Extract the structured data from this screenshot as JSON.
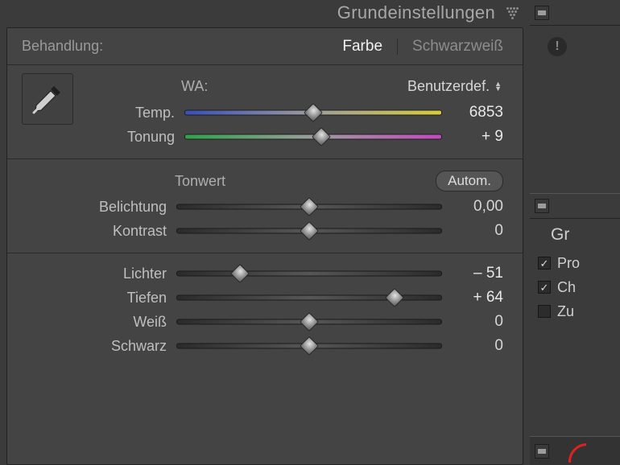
{
  "panel": {
    "title": "Grundeinstellungen",
    "treatment_label": "Behandlung:",
    "tabs": {
      "color": "Farbe",
      "bw": "Schwarzweiß"
    },
    "wa": {
      "label": "WA:",
      "dropdown": "Benutzerdef."
    },
    "sliders": {
      "temp": {
        "label": "Temp.",
        "value": "6853",
        "pos": 50
      },
      "tint": {
        "label": "Tonung",
        "value": "+ 9",
        "pos": 53
      },
      "exposure": {
        "label": "Belichtung",
        "value": "0,00",
        "pos": 50
      },
      "contrast": {
        "label": "Kontrast",
        "value": "0",
        "pos": 50
      },
      "highlights": {
        "label": "Lichter",
        "value": "– 51",
        "pos": 24
      },
      "shadows": {
        "label": "Tiefen",
        "value": "+ 64",
        "pos": 82
      },
      "whites": {
        "label": "Weiß",
        "value": "0",
        "pos": 50
      },
      "blacks": {
        "label": "Schwarz",
        "value": "0",
        "pos": 50
      }
    },
    "tone_label": "Tonwert",
    "auto": "Autom."
  },
  "side": {
    "heading": "Gr",
    "checks": [
      {
        "label": "Pro",
        "checked": true
      },
      {
        "label": "Ch",
        "checked": true
      },
      {
        "label": "Zu",
        "checked": false
      }
    ]
  }
}
